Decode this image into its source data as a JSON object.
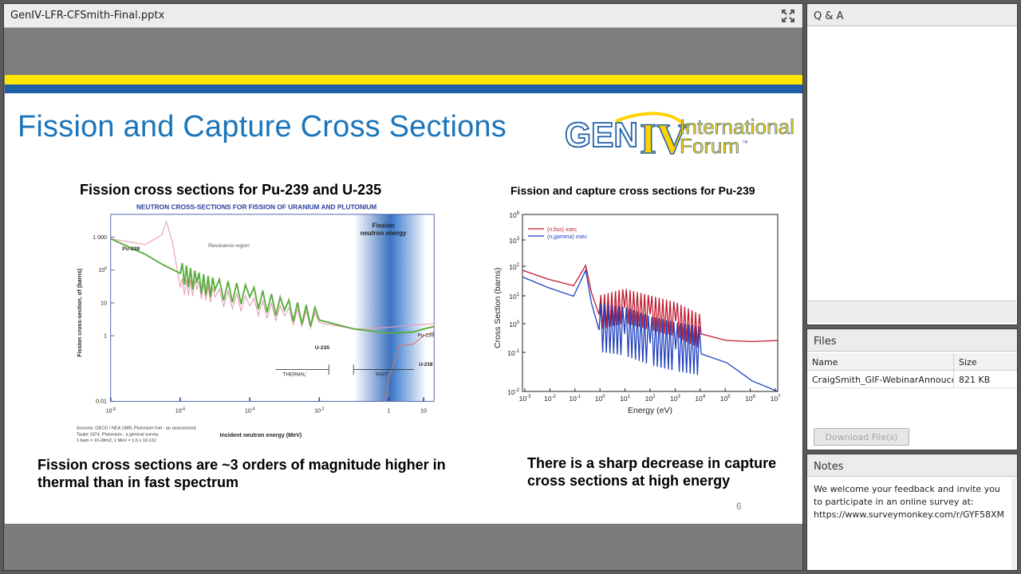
{
  "presentation": {
    "filename": "GenIV-LFR-CFSmith-Final.pptx",
    "fullscreen_icon": "expand-arrows-icon"
  },
  "slide": {
    "title": "Fission and Capture Cross Sections",
    "logo": {
      "gen": "GEN",
      "roman": "IV",
      "line1": "International",
      "line2": "Forum",
      "tm": "™"
    },
    "left_heading": "Fission cross sections for Pu-239 and U-235",
    "right_heading": "Fission and capture cross sections for Pu-239",
    "left_note": "Fission cross sections are ~3 orders of magnitude higher in thermal than in fast spectrum",
    "right_note": "There is a sharp decrease in capture cross sections at high energy",
    "page_number": "6"
  },
  "chart_data": [
    {
      "type": "line",
      "title": "NEUTRON CROSS-SECTIONS FOR FISSION OF URANIUM AND PLUTONIUM",
      "xlabel": "Incident neutron energy (MeV)",
      "ylabel": "Fission cross-section, σf (barns)",
      "x_log": true,
      "y_log": true,
      "x_ticks": [
        "10-8",
        "10-6",
        "10-4",
        "10-2",
        "1",
        "10"
      ],
      "y_ticks": [
        "1 000",
        "100",
        "10",
        "1",
        "0.01"
      ],
      "xlim": [
        1e-08,
        20
      ],
      "ylim": [
        0.01,
        5000
      ],
      "annotations": [
        "Resonance region",
        "Fission neutron energy",
        "Pu-239",
        "U-235",
        "Pu-239",
        "U-238",
        "'THERMAL'",
        "'FAST'"
      ],
      "series": [
        {
          "name": "Pu-239",
          "color": "#e8a0b0",
          "x": [
            1e-08,
            1e-07,
            3e-07,
            4e-07,
            6e-07,
            1e-06,
            3e-06,
            1e-05,
            0.0001,
            0.001,
            0.01,
            0.1,
            1,
            5,
            10,
            20
          ],
          "y": [
            900,
            600,
            1200,
            3000,
            700,
            30,
            25,
            15,
            8,
            4,
            2.5,
            1.6,
            1.8,
            2.1,
            2.2,
            2.3
          ]
        },
        {
          "name": "U-235",
          "color": "#5aad3e",
          "x": [
            1e-08,
            1e-07,
            3e-07,
            1e-06,
            3e-06,
            1e-05,
            0.0001,
            0.001,
            0.01,
            0.1,
            1,
            5,
            10,
            20
          ],
          "y": [
            900,
            300,
            150,
            80,
            40,
            25,
            15,
            6,
            3,
            1.6,
            1.2,
            1.3,
            1.6,
            1.9
          ]
        },
        {
          "name": "U-238",
          "color": "#d27a5e",
          "x": [
            0.8,
            1,
            2,
            5,
            10,
            20
          ],
          "y": [
            0.01,
            0.05,
            0.5,
            0.55,
            1.0,
            1.3
          ]
        }
      ],
      "sources": [
        "Sources: OECD / NEA 1989, Plutonium fuel - an assessment.",
        "Taube 1974, Plutonium - a general survey.",
        "1 barn = 10-28m2, 1 MeV = 1.6 x 10-13J"
      ]
    },
    {
      "type": "line",
      "title": "",
      "xlabel": "Energy (eV)",
      "ylabel": "Cross Section (barns)",
      "x_log": true,
      "y_log": true,
      "x_ticks": [
        "10-3",
        "10-2",
        "10-1",
        "100",
        "101",
        "102",
        "103",
        "104",
        "105",
        "106",
        "107"
      ],
      "y_ticks": [
        "106",
        "103",
        "102",
        "101",
        "100",
        "10-1",
        "10-2"
      ],
      "xlim": [
        0.001,
        10000000.0
      ],
      "ylim": [
        0.01,
        1000000.0
      ],
      "legend": "top-left",
      "series": [
        {
          "name": "(n,fiss) xsec",
          "color": "#c0192d",
          "x": [
            0.001,
            0.01,
            0.1,
            0.3,
            0.5,
            1,
            10,
            100,
            1000,
            10000,
            100000,
            1000000,
            10000000
          ],
          "y": [
            3000,
            1200,
            600,
            5000,
            300,
            30,
            60,
            30,
            15,
            4,
            2,
            1.8,
            2
          ]
        },
        {
          "name": "(n,gamma) xsec",
          "color": "#1f3fbf",
          "x": [
            0.001,
            0.01,
            0.1,
            0.3,
            0.5,
            1,
            10,
            100,
            1000,
            10000,
            100000,
            1000000,
            10000000
          ],
          "y": [
            1500,
            500,
            200,
            3000,
            100,
            6,
            4,
            1.5,
            0.8,
            0.5,
            0.2,
            0.03,
            0.01
          ]
        }
      ]
    }
  ],
  "qa": {
    "title": "Q & A"
  },
  "files": {
    "title": "Files",
    "columns": {
      "name": "Name",
      "size": "Size"
    },
    "rows": [
      {
        "name": "CraigSmith_GIF-WebinarAnnoucement",
        "size": "821 KB"
      }
    ],
    "download_label": "Download File(s)"
  },
  "notes": {
    "title": "Notes",
    "text": "We welcome your feedback and invite you to participate in an online survey at: https://www.surveymonkey.com/r/GYF58XM"
  }
}
